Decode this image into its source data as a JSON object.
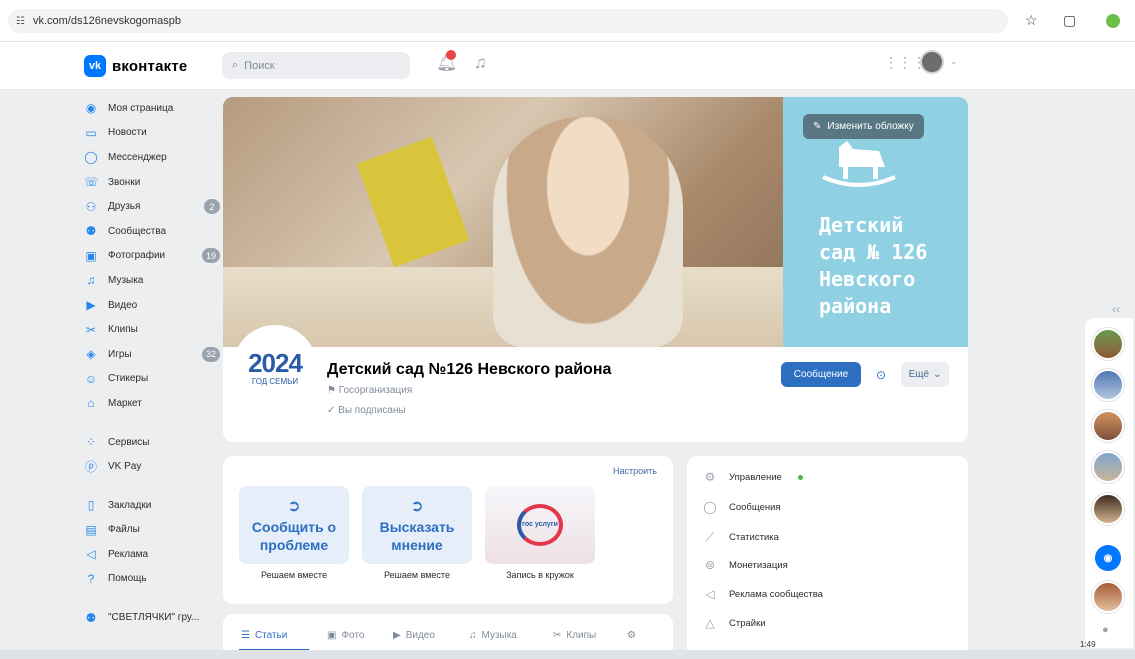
{
  "browser": {
    "url": "vk.com/ds126nevskogomaspb"
  },
  "header": {
    "logo_text": "вконтакте",
    "logo_mark": "vk",
    "search_placeholder": "Поиск"
  },
  "sidebar": {
    "items": [
      {
        "label": "Моя страница",
        "icon": "user-icon"
      },
      {
        "label": "Новости",
        "icon": "news-icon"
      },
      {
        "label": "Мессенджер",
        "icon": "message-icon"
      },
      {
        "label": "Звонки",
        "icon": "phone-icon"
      },
      {
        "label": "Друзья",
        "icon": "friends-icon",
        "badge": "2"
      },
      {
        "label": "Сообщества",
        "icon": "communities-icon"
      },
      {
        "label": "Фотографии",
        "icon": "photo-icon",
        "badge": "19"
      },
      {
        "label": "Музыка",
        "icon": "music-icon"
      },
      {
        "label": "Видео",
        "icon": "video-icon"
      },
      {
        "label": "Клипы",
        "icon": "clips-icon"
      },
      {
        "label": "Игры",
        "icon": "games-icon",
        "badge": "32"
      },
      {
        "label": "Стикеры",
        "icon": "sticker-icon"
      },
      {
        "label": "Маркет",
        "icon": "market-icon"
      }
    ],
    "items2": [
      {
        "label": "Сервисы",
        "icon": "services-icon"
      },
      {
        "label": "VK Pay",
        "icon": "vkpay-icon"
      }
    ],
    "items3": [
      {
        "label": "Закладки",
        "icon": "bookmark-icon"
      },
      {
        "label": "Файлы",
        "icon": "file-icon"
      },
      {
        "label": "Реклама",
        "icon": "ads-icon"
      },
      {
        "label": "Помощь",
        "icon": "help-icon"
      }
    ],
    "items4": [
      {
        "label": "\"СВЕТЛЯЧКИ\" гру...",
        "icon": "group-icon"
      }
    ]
  },
  "cover": {
    "edit_label": "Изменить обложку",
    "title": "Детский\nсад № 126\nНевского\nрайона",
    "accent": "#8fd0e3"
  },
  "profile": {
    "avatar_year": "2024",
    "avatar_sub": "ГОД СЕМЬИ",
    "name": "Детский сад №126 Невского района",
    "type": "Госорганизация",
    "subscribed": "Вы подписаны",
    "message_btn": "Сообщение",
    "more_btn": "Ещё"
  },
  "widgets": {
    "configure": "Настроить",
    "tiles": [
      {
        "title": "Сообщить о проблеме",
        "caption": "Решаем вместе"
      },
      {
        "title": "Высказать мнение",
        "caption": "Решаем вместе"
      },
      {
        "title": "",
        "caption": "Запись в кружок",
        "logo": "гос услуги"
      }
    ]
  },
  "tabs": [
    {
      "label": "Статьи",
      "icon": "articles-icon"
    },
    {
      "label": "Фото",
      "icon": "photo-icon"
    },
    {
      "label": "Видео",
      "icon": "video-icon"
    },
    {
      "label": "Музыка",
      "icon": "music-icon"
    },
    {
      "label": "Клипы",
      "icon": "clips-icon"
    }
  ],
  "admin_menu": [
    {
      "label": "Управление",
      "icon": "gear-icon"
    },
    {
      "label": "Сообщения",
      "icon": "message-icon"
    },
    {
      "label": "Статистика",
      "icon": "stats-icon"
    },
    {
      "label": "Монетизация",
      "icon": "money-icon"
    },
    {
      "label": "Реклама сообщества",
      "icon": "ads-icon"
    },
    {
      "label": "Страйки",
      "icon": "warning-icon"
    }
  ],
  "taskbar": {
    "time": "1:49"
  },
  "colors": {
    "brand": "#0077ff",
    "accent_button": "#2d6fc1",
    "background": "#edeef0"
  }
}
